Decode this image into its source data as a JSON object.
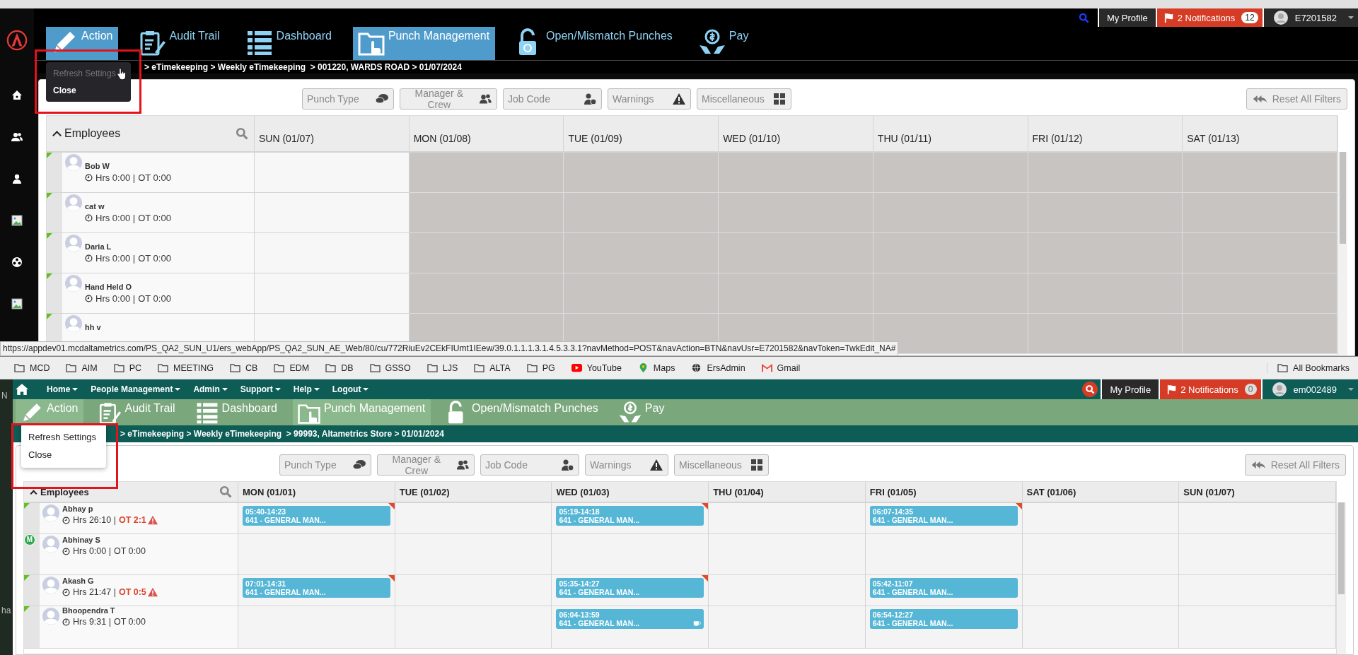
{
  "desktop_fragments": [
    {
      "text": "N"
    },
    {
      "text": "ha"
    }
  ],
  "screens": [
    {
      "kind": "dark",
      "profile_label": "My Profile",
      "notifications": {
        "label": "2 Notifications",
        "count": "12"
      },
      "user": "E7201582",
      "nav_tiles": [
        {
          "label": "Action",
          "selected": true
        },
        {
          "label": "Audit Trail",
          "selected": false
        },
        {
          "label": "Dashboard",
          "selected": false
        },
        {
          "label": "Punch Management",
          "selected": true
        },
        {
          "label": "Open/Mismatch Punches",
          "selected": false
        },
        {
          "label": "Pay",
          "selected": false
        }
      ],
      "breadcrumb": "> eTimekeeping > Weekly eTimekeeping  > 001220, WARDS ROAD > 01/07/2024",
      "menu": {
        "items": [
          {
            "label": "Refresh Settings",
            "dimmed": true
          },
          {
            "label": "Close",
            "dimmed": false
          }
        ]
      },
      "filters": [
        {
          "label": "Punch Type"
        },
        {
          "label": "Manager & Crew"
        },
        {
          "label": "Job Code"
        },
        {
          "label": "Warnings"
        },
        {
          "label": "Miscellaneous"
        }
      ],
      "reset_label": "Reset All Filters",
      "employees_label": "Employees",
      "days": [
        {
          "label": "SUN (01/07)",
          "disabled": false
        },
        {
          "label": "MON (01/08)",
          "disabled": true
        },
        {
          "label": "TUE (01/09)",
          "disabled": true
        },
        {
          "label": "WED (01/10)",
          "disabled": true
        },
        {
          "label": "THU (01/11)",
          "disabled": true
        },
        {
          "label": "FRI (01/12)",
          "disabled": true
        },
        {
          "label": "SAT (01/13)",
          "disabled": true
        }
      ],
      "rows": [
        {
          "name": "Bob W",
          "hours": "Hrs 0:00 |",
          "ot": "OT 0:00",
          "ot_warning": false,
          "flag": true,
          "cells": [
            {
              "kind": "empty"
            },
            {
              "kind": "empty"
            },
            {
              "kind": "empty"
            },
            {
              "kind": "empty"
            },
            {
              "kind": "empty"
            },
            {
              "kind": "empty"
            },
            {
              "kind": "empty"
            }
          ]
        },
        {
          "name": "cat w",
          "hours": "Hrs 0:00 |",
          "ot": "OT 0:00",
          "ot_warning": false,
          "flag": true,
          "cells": [
            {
              "kind": "empty"
            },
            {
              "kind": "empty"
            },
            {
              "kind": "empty"
            },
            {
              "kind": "empty"
            },
            {
              "kind": "empty"
            },
            {
              "kind": "empty"
            },
            {
              "kind": "empty"
            }
          ]
        },
        {
          "name": "Daria L",
          "hours": "Hrs 0:00 |",
          "ot": "OT 0:00",
          "ot_warning": false,
          "flag": true,
          "cells": [
            {
              "kind": "empty"
            },
            {
              "kind": "empty"
            },
            {
              "kind": "empty"
            },
            {
              "kind": "empty"
            },
            {
              "kind": "empty"
            },
            {
              "kind": "empty"
            },
            {
              "kind": "empty"
            }
          ]
        },
        {
          "name": "Hand Held O",
          "hours": "Hrs 0:00 |",
          "ot": "OT 0:00",
          "ot_warning": false,
          "flag": true,
          "cells": [
            {
              "kind": "empty"
            },
            {
              "kind": "empty"
            },
            {
              "kind": "empty"
            },
            {
              "kind": "empty"
            },
            {
              "kind": "empty"
            },
            {
              "kind": "empty"
            },
            {
              "kind": "empty"
            }
          ]
        },
        {
          "name": "hh v",
          "flag": true,
          "cells": [
            {
              "kind": "empty"
            },
            {
              "kind": "empty"
            },
            {
              "kind": "empty"
            },
            {
              "kind": "empty"
            },
            {
              "kind": "empty"
            },
            {
              "kind": "empty"
            },
            {
              "kind": "empty"
            }
          ]
        }
      ]
    },
    {
      "kind": "green",
      "top_links": [
        {
          "label": "Home"
        },
        {
          "label": "People Management"
        },
        {
          "label": "Admin"
        },
        {
          "label": "Support"
        },
        {
          "label": "Help"
        },
        {
          "label": "Logout"
        }
      ],
      "profile_label": "My Profile",
      "notifications": {
        "label": "2 Notifications",
        "count": "0"
      },
      "user": "em002489",
      "nav_tiles": [
        {
          "label": "Action",
          "selected": true
        },
        {
          "label": "Audit Trail",
          "selected": false
        },
        {
          "label": "Dashboard",
          "selected": false
        },
        {
          "label": "Punch Management",
          "selected": true
        },
        {
          "label": "Open/Mismatch Punches",
          "selected": false
        },
        {
          "label": "Pay",
          "selected": false
        }
      ],
      "breadcrumb": "> eTimekeeping > Weekly eTimekeeping  > 99993, Altametrics Store > 01/01/2024",
      "menu": {
        "items": [
          {
            "label": "Refresh Settings",
            "dimmed": false
          },
          {
            "label": "Close",
            "dimmed": false
          }
        ]
      },
      "filters": [
        {
          "label": "Punch Type"
        },
        {
          "label": "Manager & Crew"
        },
        {
          "label": "Job Code"
        },
        {
          "label": "Warnings"
        },
        {
          "label": "Miscellaneous"
        }
      ],
      "reset_label": "Reset All Filters",
      "employees_label": "Employees",
      "days": [
        {
          "label": "MON (01/01)",
          "disabled": false
        },
        {
          "label": "TUE (01/02)",
          "disabled": false
        },
        {
          "label": "WED (01/03)",
          "disabled": false
        },
        {
          "label": "THU (01/04)",
          "disabled": false
        },
        {
          "label": "FRI (01/05)",
          "disabled": false
        },
        {
          "label": "SAT (01/06)",
          "disabled": false
        },
        {
          "label": "SUN (01/07)",
          "disabled": false
        }
      ],
      "rows": [
        {
          "name": "Abhay p",
          "hours": "Hrs 26:10 |",
          "ot": "OT 2:1",
          "ot_warning": true,
          "flag": true,
          "cells": [
            {
              "kind": "punch",
              "time": "05:40-14:23",
              "code": "641 - GENERAL MAN...",
              "alert": true,
              "break": false
            },
            {
              "kind": "empty"
            },
            {
              "kind": "punch",
              "time": "05:19-14:18",
              "code": "641 - GENERAL MAN...",
              "alert": true,
              "break": false
            },
            {
              "kind": "empty"
            },
            {
              "kind": "punch",
              "time": "06:07-14:35",
              "code": "641 - GENERAL MAN...",
              "alert": true,
              "break": false
            },
            {
              "kind": "empty"
            },
            {
              "kind": "empty"
            }
          ]
        },
        {
          "name": "Abhinay S",
          "hours": "Hrs 0:00 |",
          "ot": "OT 0:00",
          "ot_warning": false,
          "flag": false,
          "badge": "M",
          "cells": [
            {
              "kind": "empty"
            },
            {
              "kind": "empty"
            },
            {
              "kind": "empty"
            },
            {
              "kind": "empty"
            },
            {
              "kind": "empty"
            },
            {
              "kind": "empty"
            },
            {
              "kind": "empty"
            }
          ]
        },
        {
          "name": "Akash G",
          "hours": "Hrs 21:47 |",
          "ot": "OT 0:5",
          "ot_warning": true,
          "flag": true,
          "cells": [
            {
              "kind": "punch",
              "time": "07:01-14:31",
              "code": "641 - GENERAL MAN...",
              "alert": true,
              "break": false
            },
            {
              "kind": "empty"
            },
            {
              "kind": "punch",
              "time": "05:35-14:27",
              "code": "641 - GENERAL MAN...",
              "alert": true,
              "break": false
            },
            {
              "kind": "empty"
            },
            {
              "kind": "punch",
              "time": "05:42-11:07",
              "code": "641 - GENERAL MAN...",
              "alert": false,
              "break": false
            },
            {
              "kind": "empty"
            },
            {
              "kind": "empty"
            }
          ]
        },
        {
          "name": "Bhoopendra T",
          "hours": "Hrs 9:31 |",
          "ot": "OT 0:00",
          "ot_warning": false,
          "flag": true,
          "cells": [
            {
              "kind": "empty"
            },
            {
              "kind": "empty"
            },
            {
              "kind": "punch",
              "time": "06:04-13:59",
              "code": "641 - GENERAL MAN...",
              "alert": false,
              "break": true
            },
            {
              "kind": "empty"
            },
            {
              "kind": "punch",
              "time": "06:54-12:27",
              "code": "641 - GENERAL MAN...",
              "alert": false,
              "break": false
            },
            {
              "kind": "empty"
            },
            {
              "kind": "empty"
            }
          ]
        }
      ]
    }
  ],
  "bookmarks": {
    "items": [
      {
        "label": "MCD",
        "kind": "folder"
      },
      {
        "label": "AIM",
        "kind": "folder"
      },
      {
        "label": "PC",
        "kind": "folder"
      },
      {
        "label": "MEETING",
        "kind": "folder"
      },
      {
        "label": "CB",
        "kind": "folder"
      },
      {
        "label": "EDM",
        "kind": "folder"
      },
      {
        "label": "DB",
        "kind": "folder"
      },
      {
        "label": "GSSO",
        "kind": "folder"
      },
      {
        "label": "LJS",
        "kind": "folder"
      },
      {
        "label": "ALTA",
        "kind": "folder"
      },
      {
        "label": "PG",
        "kind": "folder"
      },
      {
        "label": "YouTube",
        "kind": "video"
      },
      {
        "label": "Maps",
        "kind": "pin"
      },
      {
        "label": "ErsAdmin",
        "kind": "globe"
      },
      {
        "label": "Gmail",
        "kind": "mail"
      }
    ],
    "all_label": "All Bookmarks"
  },
  "status_url": "https://appdev01.mcdaltametrics.com/PS_QA2_SUN_U1/ers_webApp/PS_QA2_SUN_AE_Web/80/cu/772RiuEv2CEkFIUmt1IEew/39.0.1.1.1.3.1.4.5.3.3.1?navMethod=POST&navAction=BTN&navUsr=E7201582&navToken=TwkEdit_NA#"
}
